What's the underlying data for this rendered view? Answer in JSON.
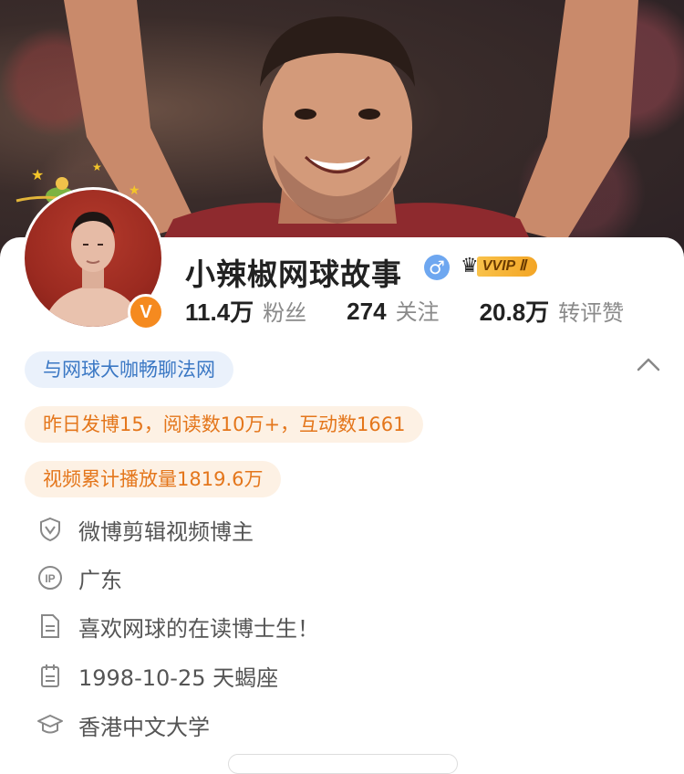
{
  "profile": {
    "name": "小辣椒网球故事",
    "gender_symbol": "♂",
    "verified_symbol": "V",
    "vvip_label": "VVIP Ⅱ",
    "vvip_crown": "♛"
  },
  "stats": [
    {
      "value": "11.4万",
      "label": "粉丝"
    },
    {
      "value": "274",
      "label": "关注"
    },
    {
      "value": "20.8万",
      "label": "转评赞"
    }
  ],
  "tags": {
    "intro": "与网球大咖畅聊法网",
    "yesterday": "昨日发博15，阅读数10万+，互动数1661",
    "video": "视频累计播放量1819.6万"
  },
  "info": {
    "role": "微博剪辑视频博主",
    "location": "广东",
    "bio": "喜欢网球的在读博士生！",
    "birthday": "1998-10-25 天蝎座",
    "school": "香港中文大学"
  },
  "colors": {
    "accent_orange": "#f58a1f",
    "tag_blue": "#3b78c4",
    "tag_orange": "#e4761b",
    "gender_blue": "#6ea7f0"
  },
  "icons": [
    "shield-icon",
    "ip-icon",
    "document-icon",
    "calendar-icon",
    "graduation-cap-icon",
    "chevron-up-icon"
  ]
}
